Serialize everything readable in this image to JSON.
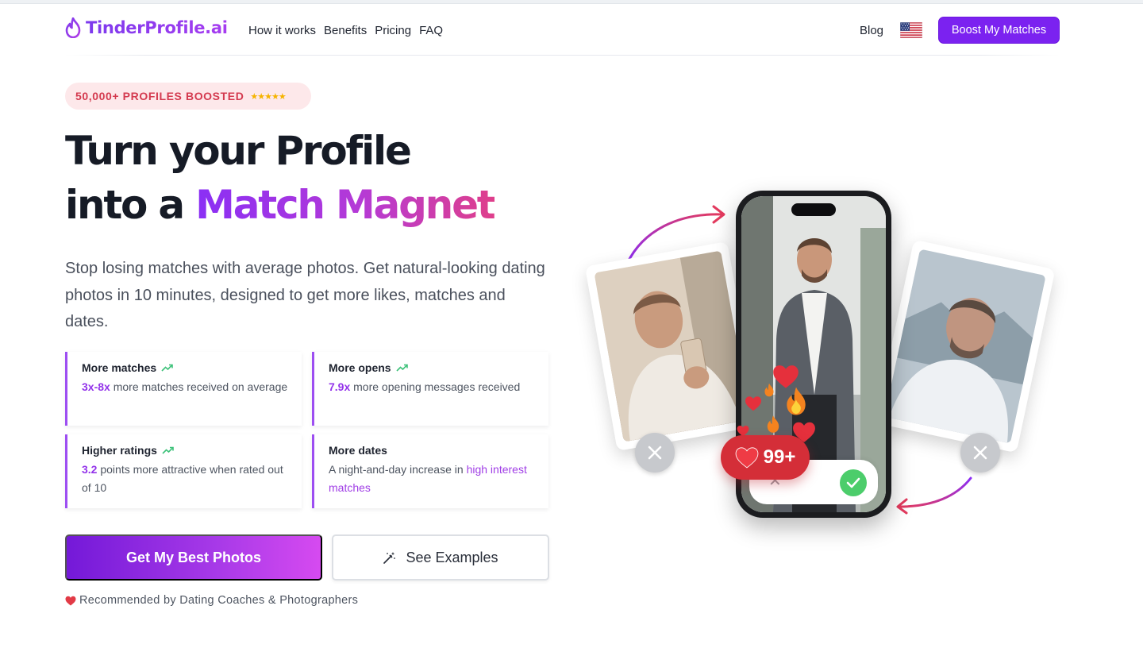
{
  "nav": {
    "logo": "TinderProfile.ai",
    "links": [
      "How it works",
      "Benefits",
      "Pricing",
      "FAQ"
    ],
    "blog": "Blog",
    "cta": "Boost My Matches"
  },
  "hero": {
    "badge": "50,000+ PROFILES BOOSTED",
    "badge_stars": "★★★★★",
    "title_line1": "Turn your Profile",
    "title_line2_prefix": "into a ",
    "title_line2_highlight": "Match Magnet",
    "subtitle": "Stop losing matches with average photos. Get natural-looking dating photos in 10 minutes, designed to get more likes, matches and dates."
  },
  "features": [
    {
      "title": "More matches",
      "highlight": "3x-8x",
      "text": " more matches received on average"
    },
    {
      "title": "More opens",
      "highlight": "7.9x",
      "text": " more opening messages received"
    },
    {
      "title": "Higher ratings",
      "highlight": "3.2",
      "text": " points more attractive when rated out of 10"
    },
    {
      "title": "More dates",
      "text": "A night-and-day increase in ",
      "link": "high interest matches"
    }
  ],
  "cta": {
    "primary": "Get My Best Photos",
    "secondary": "See Examples",
    "recommended": "Recommended by Dating Coaches & Photographers"
  },
  "visual": {
    "count": "99+"
  },
  "colors": {
    "brand_purple": "#7b22f0",
    "badge_red": "#d43a4f",
    "like_green": "#4ccd6b",
    "count_red": "#d42e38"
  },
  "icons": [
    "flame-logo-icon",
    "us-flag-icon",
    "trend-up-icon",
    "magic-wand-icon",
    "heart-icon",
    "close-icon",
    "check-icon",
    "fire-icon"
  ]
}
